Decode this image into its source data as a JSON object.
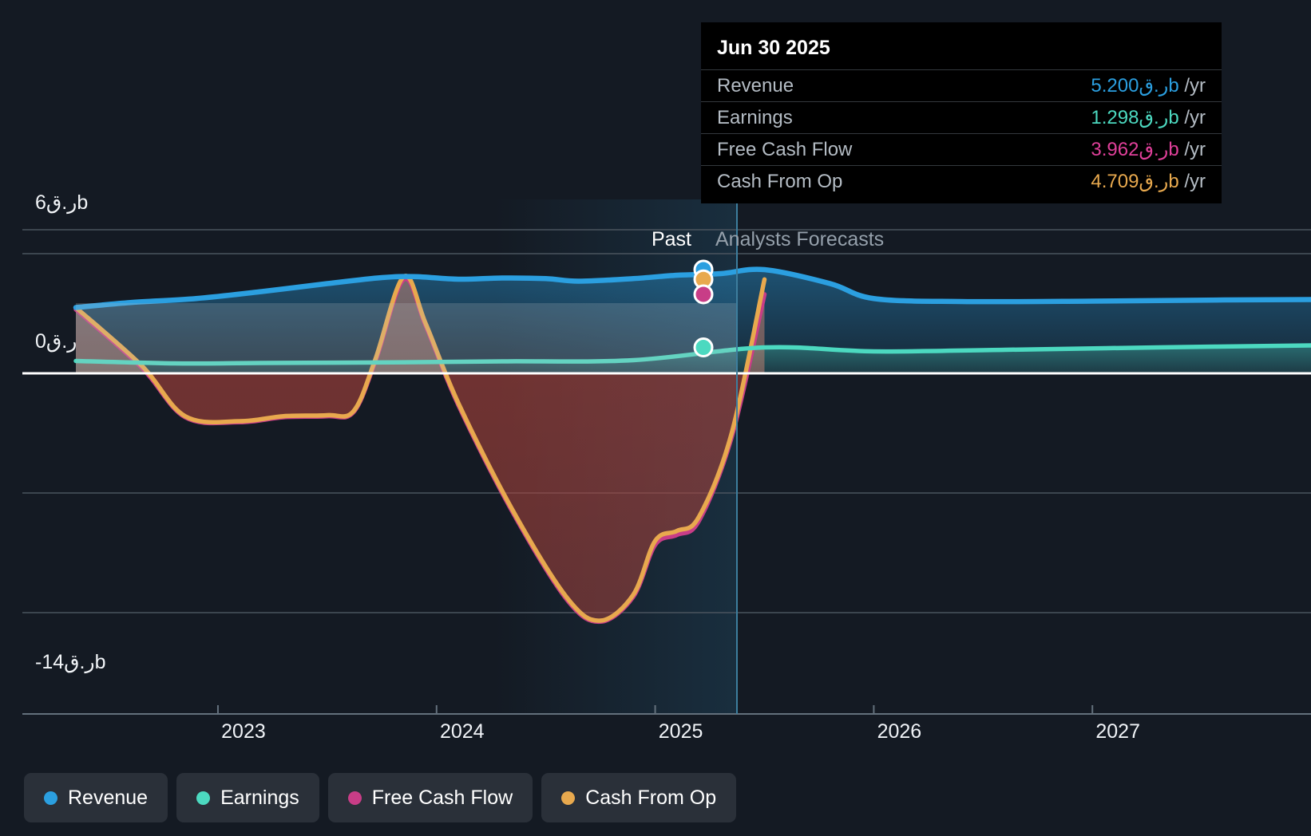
{
  "chart_data": {
    "type": "area",
    "title": "",
    "xlabel": "",
    "ylabel": "",
    "currency": "ر.ق",
    "unit": "b",
    "x_ticks": [
      "2023",
      "2024",
      "2025",
      "2026",
      "2027"
    ],
    "y_ticks": [
      "6ر.قb",
      "0ر.ق",
      "-14ر.قb"
    ],
    "ylim": [
      -14,
      6
    ],
    "grid": true,
    "legend_position": "bottom-left",
    "forecast_divider": {
      "past_label": "Past",
      "forecast_label": "Analysts Forecasts",
      "date": "2025.5"
    },
    "series": [
      {
        "name": "Revenue",
        "color": "#2b9fe0",
        "points": [
          [
            2022.35,
            3.3
          ],
          [
            2022.6,
            3.55
          ],
          [
            2022.9,
            3.75
          ],
          [
            2023.2,
            4.1
          ],
          [
            2023.5,
            4.5
          ],
          [
            2023.75,
            4.8
          ],
          [
            2023.9,
            4.85
          ],
          [
            2024.1,
            4.72
          ],
          [
            2024.3,
            4.78
          ],
          [
            2024.5,
            4.75
          ],
          [
            2024.65,
            4.62
          ],
          [
            2024.9,
            4.75
          ],
          [
            2025.1,
            4.92
          ],
          [
            2025.3,
            5.0
          ],
          [
            2025.5,
            5.2
          ],
          [
            2025.8,
            4.5
          ],
          [
            2026.0,
            3.75
          ],
          [
            2026.4,
            3.6
          ],
          [
            2027.0,
            3.62
          ],
          [
            2027.6,
            3.68
          ],
          [
            2028.0,
            3.7
          ]
        ]
      },
      {
        "name": "Earnings",
        "color": "#4cd9c0",
        "points": [
          [
            2022.35,
            0.62
          ],
          [
            2022.8,
            0.5
          ],
          [
            2023.2,
            0.52
          ],
          [
            2023.8,
            0.55
          ],
          [
            2024.3,
            0.6
          ],
          [
            2024.9,
            0.66
          ],
          [
            2025.5,
            1.298
          ],
          [
            2026.0,
            1.1
          ],
          [
            2026.6,
            1.18
          ],
          [
            2027.3,
            1.3
          ],
          [
            2028.0,
            1.4
          ]
        ]
      },
      {
        "name": "Free Cash Flow",
        "color": "#c83d87",
        "points": [
          [
            2022.35,
            3.2
          ],
          [
            2022.65,
            0.3
          ],
          [
            2022.85,
            -2.2
          ],
          [
            2023.1,
            -2.45
          ],
          [
            2023.3,
            -2.2
          ],
          [
            2023.5,
            -2.15
          ],
          [
            2023.62,
            -1.95
          ],
          [
            2023.72,
            0.6
          ],
          [
            2023.85,
            4.7
          ],
          [
            2023.95,
            2.4
          ],
          [
            2024.1,
            -1.6
          ],
          [
            2024.35,
            -7.0
          ],
          [
            2024.6,
            -11.4
          ],
          [
            2024.75,
            -12.45
          ],
          [
            2024.9,
            -11.2
          ],
          [
            2025.0,
            -8.6
          ],
          [
            2025.1,
            -8.1
          ],
          [
            2025.2,
            -7.4
          ],
          [
            2025.35,
            -3.2
          ],
          [
            2025.5,
            3.962
          ]
        ]
      },
      {
        "name": "Cash From Op",
        "color": "#e8a94e",
        "points": [
          [
            2022.35,
            3.3
          ],
          [
            2022.65,
            0.4
          ],
          [
            2022.85,
            -2.15
          ],
          [
            2023.1,
            -2.4
          ],
          [
            2023.3,
            -2.15
          ],
          [
            2023.5,
            -2.1
          ],
          [
            2023.62,
            -1.9
          ],
          [
            2023.72,
            0.7
          ],
          [
            2023.85,
            4.85
          ],
          [
            2023.95,
            2.5
          ],
          [
            2024.1,
            -1.5
          ],
          [
            2024.35,
            -6.9
          ],
          [
            2024.6,
            -11.3
          ],
          [
            2024.75,
            -12.4
          ],
          [
            2024.9,
            -11.1
          ],
          [
            2025.0,
            -8.4
          ],
          [
            2025.1,
            -7.9
          ],
          [
            2025.2,
            -7.2
          ],
          [
            2025.35,
            -3.0
          ],
          [
            2025.5,
            4.709
          ]
        ]
      }
    ]
  },
  "tooltip": {
    "title": "Jun 30 2025",
    "rows": [
      {
        "label": "Revenue",
        "value": "5.200ر.قb",
        "suffix": " /yr",
        "color": "#2b9fe0"
      },
      {
        "label": "Earnings",
        "value": "1.298ر.قb",
        "suffix": " /yr",
        "color": "#4cd9c0"
      },
      {
        "label": "Free Cash Flow",
        "value": "3.962ر.قb",
        "suffix": " /yr",
        "color": "#e0409a"
      },
      {
        "label": "Cash From Op",
        "value": "4.709ر.قb",
        "suffix": " /yr",
        "color": "#e8a94e"
      }
    ]
  },
  "legend": {
    "items": [
      {
        "label": "Revenue",
        "color": "#2b9fe0"
      },
      {
        "label": "Earnings",
        "color": "#4cd9c0"
      },
      {
        "label": "Free Cash Flow",
        "color": "#c83d87"
      },
      {
        "label": "Cash From Op",
        "color": "#e8a94e"
      }
    ]
  },
  "axes": {
    "y_top_label": "6ر.قb",
    "y_zero_label": "0ر.ق",
    "y_bottom_label": "-14ر.قb",
    "years": [
      "2023",
      "2024",
      "2025",
      "2026",
      "2027"
    ]
  },
  "divider": {
    "past": "Past",
    "forecast": "Analysts Forecasts"
  }
}
